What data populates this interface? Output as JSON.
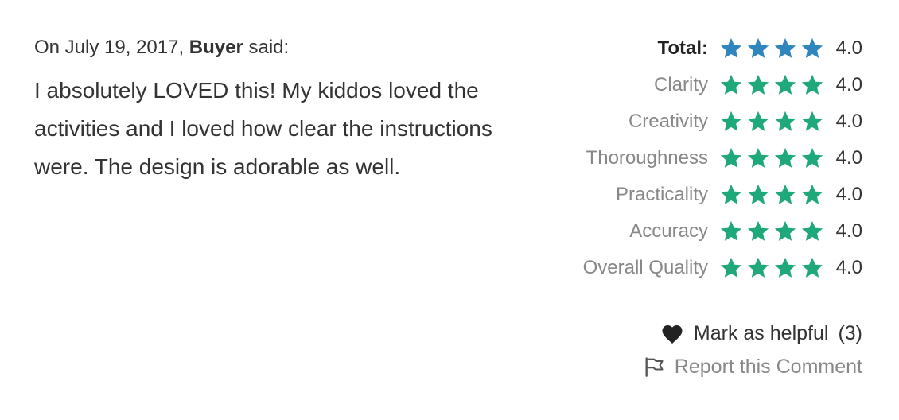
{
  "review": {
    "date_prefix": "On July 19, 2017,",
    "author": "Buyer",
    "said": "said:",
    "body": "I absolutely LOVED this! My kiddos loved the activities and I loved how clear the instructions were. The design is adorable as well."
  },
  "ratings": [
    {
      "label": "Total:",
      "value": "4.0",
      "stars": 4,
      "kind": "total"
    },
    {
      "label": "Clarity",
      "value": "4.0",
      "stars": 4,
      "kind": "category"
    },
    {
      "label": "Creativity",
      "value": "4.0",
      "stars": 4,
      "kind": "category"
    },
    {
      "label": "Thoroughness",
      "value": "4.0",
      "stars": 4,
      "kind": "category"
    },
    {
      "label": "Practicality",
      "value": "4.0",
      "stars": 4,
      "kind": "category"
    },
    {
      "label": "Accuracy",
      "value": "4.0",
      "stars": 4,
      "kind": "category"
    },
    {
      "label": "Overall Quality",
      "value": "4.0",
      "stars": 4,
      "kind": "category"
    }
  ],
  "actions": {
    "helpful_label": "Mark as helpful",
    "helpful_count": "(3)",
    "report_label": "Report this Comment",
    "helpful_icon": "heart-icon",
    "report_icon": "flag-icon"
  },
  "colors": {
    "total_star": "#2F86BD",
    "category_star": "#1FA87A",
    "text": "#333333",
    "muted": "#888888"
  }
}
